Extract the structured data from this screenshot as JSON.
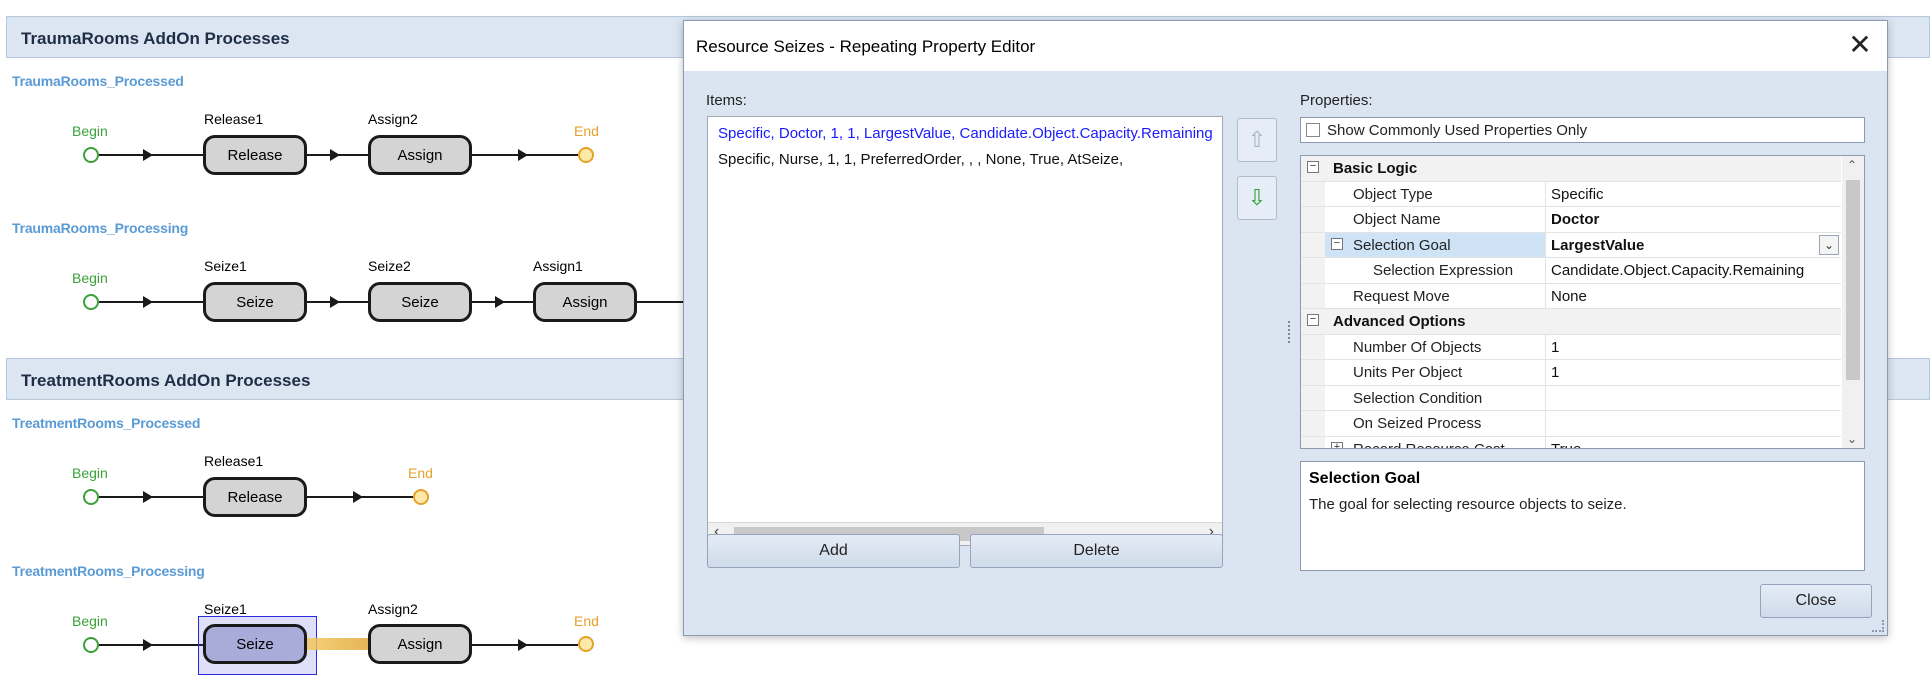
{
  "sections": [
    {
      "title": "TraumaRooms AddOn Processes"
    },
    {
      "title": "TreatmentRooms AddOn Processes"
    }
  ],
  "processes": [
    {
      "name": "TraumaRooms_Processed",
      "begin": "Begin",
      "end": "End",
      "steps": [
        {
          "label": "Release1",
          "text": "Release"
        },
        {
          "label": "Assign2",
          "text": "Assign"
        }
      ]
    },
    {
      "name": "TraumaRooms_Processing",
      "begin": "Begin",
      "steps": [
        {
          "label": "Seize1",
          "text": "Seize"
        },
        {
          "label": "Seize2",
          "text": "Seize"
        },
        {
          "label": "Assign1",
          "text": "Assign"
        }
      ]
    },
    {
      "name": "TreatmentRooms_Processed",
      "begin": "Begin",
      "end": "End",
      "steps": [
        {
          "label": "Release1",
          "text": "Release"
        }
      ]
    },
    {
      "name": "TreatmentRooms_Processing",
      "begin": "Begin",
      "end": "End",
      "steps": [
        {
          "label": "Seize1",
          "text": "Seize"
        },
        {
          "label": "Assign2",
          "text": "Assign"
        }
      ]
    }
  ],
  "dialog": {
    "title": "Resource Seizes - Repeating Property Editor",
    "close_glyph": "✕",
    "items_label": "Items:",
    "items": [
      "Specific, Doctor, 1, 1, LargestValue, Candidate.Object.Capacity.Remaining",
      "Specific, Nurse, 1, 1, PreferredOrder, , , None, True, AtSeize,"
    ],
    "add_label": "Add",
    "delete_label": "Delete",
    "properties_label": "Properties:",
    "show_common_label": "Show Commonly Used Properties Only",
    "categories": [
      {
        "name": "Basic Logic",
        "rows": [
          {
            "name": "Object Type",
            "value": "Specific"
          },
          {
            "name": "Object Name",
            "value": "Doctor"
          },
          {
            "name": "Selection Goal",
            "value": "LargestValue"
          },
          {
            "name": "Selection Expression",
            "value": "Candidate.Object.Capacity.Remaining"
          },
          {
            "name": "Request Move",
            "value": "None"
          }
        ]
      },
      {
        "name": "Advanced Options",
        "rows": [
          {
            "name": "Number Of Objects",
            "value": "1"
          },
          {
            "name": "Units Per Object",
            "value": "1"
          },
          {
            "name": "Selection Condition",
            "value": ""
          },
          {
            "name": "On Seized Process",
            "value": ""
          },
          {
            "name": "Record Resource Cost",
            "value": "True"
          }
        ]
      }
    ],
    "description_title": "Selection Goal",
    "description_text": "The goal for selecting resource objects to seize.",
    "close_label": "Close"
  },
  "colors": {
    "begin": "#3aa13a",
    "end": "#e5a22b",
    "process_name": "#5b9bd5",
    "selected_step": "#a9acd9",
    "selected_item_text": "#1a1aff"
  }
}
